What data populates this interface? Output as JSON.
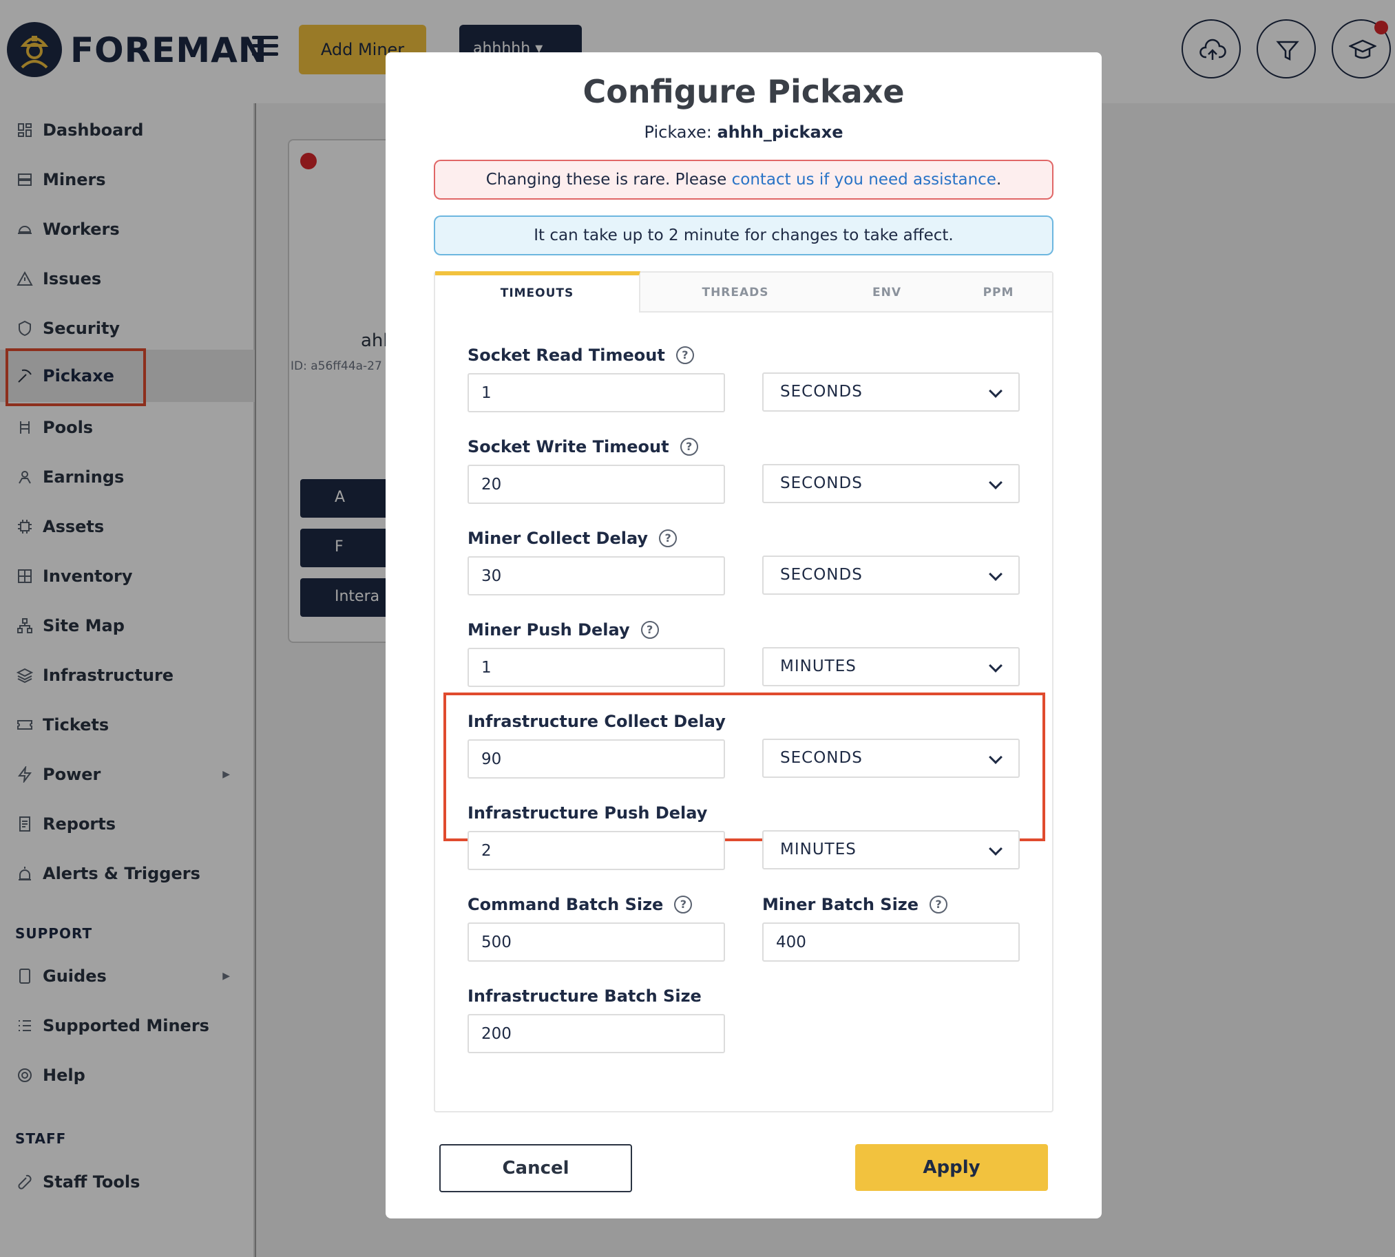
{
  "app": {
    "brand": "FOREMAN",
    "add_miner_label": "Add Miner",
    "org_selector": "ahhhhh ▾"
  },
  "sidebar": {
    "items": [
      {
        "label": "Dashboard",
        "icon": "dashboard-icon"
      },
      {
        "label": "Miners",
        "icon": "miners-icon"
      },
      {
        "label": "Workers",
        "icon": "workers-icon"
      },
      {
        "label": "Issues",
        "icon": "warning-icon"
      },
      {
        "label": "Security",
        "icon": "shield-icon"
      },
      {
        "label": "Pickaxe",
        "icon": "pickaxe-icon"
      },
      {
        "label": "Pools",
        "icon": "pools-icon"
      },
      {
        "label": "Earnings",
        "icon": "earnings-icon"
      },
      {
        "label": "Assets",
        "icon": "chip-icon"
      },
      {
        "label": "Inventory",
        "icon": "inventory-icon"
      },
      {
        "label": "Site Map",
        "icon": "sitemap-icon"
      },
      {
        "label": "Infrastructure",
        "icon": "layers-icon"
      },
      {
        "label": "Tickets",
        "icon": "ticket-icon"
      },
      {
        "label": "Power",
        "icon": "bolt-icon"
      },
      {
        "label": "Reports",
        "icon": "report-icon"
      },
      {
        "label": "Alerts & Triggers",
        "icon": "alarm-icon"
      }
    ],
    "support_heading": "SUPPORT",
    "support_items": [
      {
        "label": "Guides",
        "icon": "book-icon"
      },
      {
        "label": "Supported Miners",
        "icon": "list-icon"
      },
      {
        "label": "Help",
        "icon": "lifebuoy-icon"
      }
    ],
    "staff_heading": "STAFF",
    "staff_items": [
      {
        "label": "Staff Tools",
        "icon": "wrench-icon"
      }
    ]
  },
  "card": {
    "name": "ahh",
    "id": "ID: a56ff44a-27",
    "buttons": [
      "A",
      "F",
      "Intera"
    ]
  },
  "modal": {
    "title": "Configure Pickaxe",
    "subtitle_prefix": "Pickaxe:",
    "subtitle_name": "ahhh_pickaxe",
    "warning_text": "Changing these is rare. Please ",
    "warning_link": "contact us if you need assistance",
    "warning_end": ".",
    "info_text": "It can take up to 2 minute for changes to take affect.",
    "tabs": [
      "TIMEOUTS",
      "THREADS",
      "ENV",
      "PPM"
    ],
    "fields": {
      "socket_read": {
        "label": "Socket Read Timeout",
        "value": "1",
        "unit": "SECONDS"
      },
      "socket_write": {
        "label": "Socket Write Timeout",
        "value": "20",
        "unit": "SECONDS"
      },
      "miner_collect": {
        "label": "Miner Collect Delay",
        "value": "30",
        "unit": "SECONDS"
      },
      "miner_push": {
        "label": "Miner Push Delay",
        "value": "1",
        "unit": "MINUTES"
      },
      "infra_collect": {
        "label": "Infrastructure Collect Delay",
        "value": "90",
        "unit": "SECONDS"
      },
      "infra_push": {
        "label": "Infrastructure Push Delay",
        "value": "2",
        "unit": "MINUTES"
      },
      "command_batch": {
        "label": "Command Batch Size",
        "value": "500"
      },
      "miner_batch": {
        "label": "Miner Batch Size",
        "value": "400"
      },
      "infra_batch": {
        "label": "Infrastructure Batch Size",
        "value": "200"
      }
    },
    "cancel_label": "Cancel",
    "apply_label": "Apply"
  },
  "colors": {
    "accent": "#f2c23e",
    "navy": "#1e2a44",
    "highlight": "#e04b2e",
    "link": "#2873c6"
  }
}
